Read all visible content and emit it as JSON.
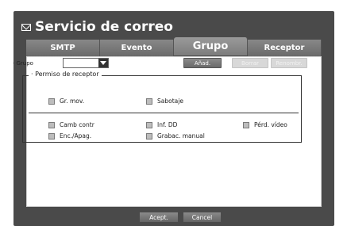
{
  "window": {
    "title": "Servicio de correo",
    "title_icon": "envelope-icon"
  },
  "tabs": [
    {
      "label": "SMTP",
      "active": false
    },
    {
      "label": "Evento",
      "active": false
    },
    {
      "label": "Grupo",
      "active": true
    },
    {
      "label": "Receptor",
      "active": false
    }
  ],
  "grupo": {
    "label": "· Grupo",
    "value": ""
  },
  "buttons": {
    "add": "Añad.",
    "delete": "Borrar",
    "rename": "Renombr.",
    "ok": "Acept.",
    "cancel": "Cancel"
  },
  "permissions": {
    "legend": "· Permiso de receptor",
    "row1": [
      {
        "label": "Gr. mov.",
        "checked": false
      },
      {
        "label": "Sabotaje",
        "checked": false
      }
    ],
    "row2": [
      {
        "label": "Camb contr",
        "checked": false
      },
      {
        "label": "Inf. DD",
        "checked": false
      },
      {
        "label": "Pérd. vídeo",
        "checked": false
      }
    ],
    "row3": [
      {
        "label": "Enc./Apag.",
        "checked": false
      },
      {
        "label": "Grabac. manual",
        "checked": false
      }
    ]
  }
}
